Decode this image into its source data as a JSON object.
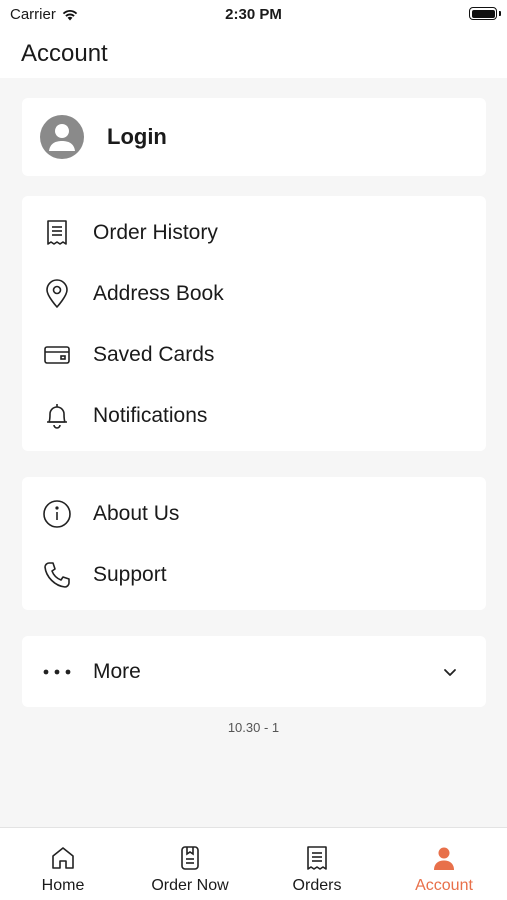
{
  "status_bar": {
    "carrier": "Carrier",
    "time": "2:30 PM"
  },
  "header": {
    "title": "Account"
  },
  "login": {
    "label": "Login",
    "icon": "user-avatar-icon"
  },
  "menu_group_1": [
    {
      "label": "Order History",
      "icon": "receipt-icon"
    },
    {
      "label": "Address Book",
      "icon": "location-pin-icon"
    },
    {
      "label": "Saved Cards",
      "icon": "credit-card-icon"
    },
    {
      "label": "Notifications",
      "icon": "bell-icon"
    }
  ],
  "menu_group_2": [
    {
      "label": "About Us",
      "icon": "info-icon"
    },
    {
      "label": "Support",
      "icon": "phone-icon"
    }
  ],
  "more": {
    "label": "More",
    "icon": "more-dots-icon"
  },
  "version": "10.30 - 1",
  "tabs": [
    {
      "label": "Home",
      "icon": "home-icon",
      "active": false
    },
    {
      "label": "Order Now",
      "icon": "order-now-icon",
      "active": false
    },
    {
      "label": "Orders",
      "icon": "orders-icon",
      "active": false
    },
    {
      "label": "Account",
      "icon": "account-icon",
      "active": true
    }
  ],
  "colors": {
    "accent": "#e8704a",
    "background": "#f6f6f6",
    "card": "#ffffff"
  }
}
